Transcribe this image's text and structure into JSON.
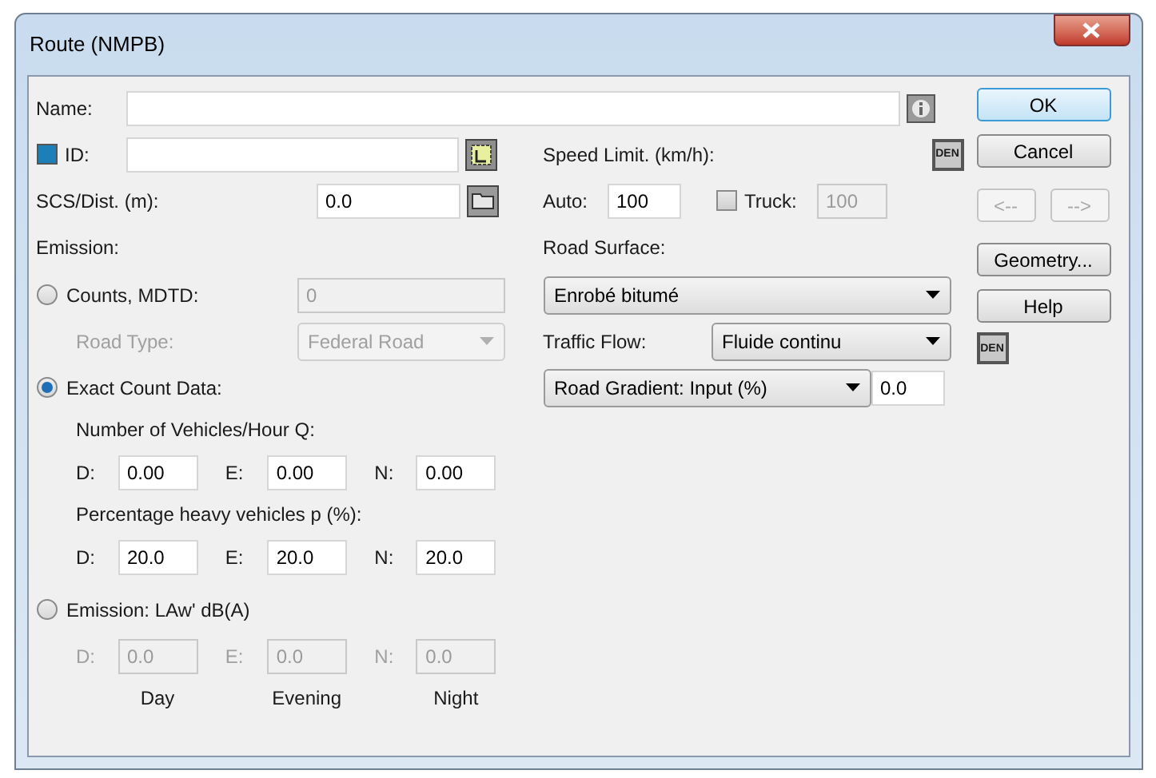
{
  "window": {
    "title": "Route (NMPB)"
  },
  "name": {
    "label": "Name:"
  },
  "id": {
    "label": "ID:",
    "checked": true
  },
  "scs_dist": {
    "label": "SCS/Dist. (m):",
    "value": "0.0"
  },
  "emission": {
    "label": "Emission:",
    "options": [
      {
        "kind": "counts",
        "label": "Counts, MDTD:",
        "selected": false,
        "value": "0",
        "road_type": {
          "label": "Road Type:",
          "value": "Federal Road"
        }
      },
      {
        "kind": "exact",
        "label": "Exact Count Data:",
        "selected": true,
        "groups": [
          {
            "label": "Number of Vehicles/Hour Q:",
            "fields": [
              {
                "label": "D:",
                "value": "0.00"
              },
              {
                "label": "E:",
                "value": "0.00"
              },
              {
                "label": "N:",
                "value": "0.00"
              }
            ]
          },
          {
            "label": "Percentage heavy vehicles p (%):",
            "fields": [
              {
                "label": "D:",
                "value": "20.0"
              },
              {
                "label": "E:",
                "value": "20.0"
              },
              {
                "label": "N:",
                "value": "20.0"
              }
            ]
          }
        ]
      },
      {
        "kind": "level",
        "label": "Emission: LAw' dB(A)",
        "selected": false,
        "fields": [
          {
            "label": "D:",
            "value": "0.0"
          },
          {
            "label": "E:",
            "value": "0.0"
          },
          {
            "label": "N:",
            "value": "0.0"
          }
        ]
      }
    ],
    "period_labels": [
      "Day",
      "Evening",
      "Night"
    ]
  },
  "speed_limit": {
    "label": "Speed Limit. (km/h):",
    "den": "DEN",
    "auto": {
      "label": "Auto:",
      "value": "100"
    },
    "truck": {
      "label": "Truck:",
      "value": "100",
      "checked": false
    }
  },
  "road_surface": {
    "label": "Road Surface:",
    "value": "Enrobé bitumé"
  },
  "traffic_flow": {
    "label": "Traffic Flow:",
    "value": "Fluide continu",
    "den": "DEN"
  },
  "road_gradient": {
    "mode": "Road Gradient: Input (%)",
    "value": "0.0"
  },
  "buttons": [
    {
      "label": "OK",
      "kind": "full",
      "default": true,
      "disabled": false
    },
    {
      "label": "Cancel",
      "kind": "full",
      "default": false,
      "disabled": false
    },
    {
      "label": "<--",
      "kind": "half",
      "default": false,
      "disabled": true
    },
    {
      "label": "-->",
      "kind": "half",
      "default": false,
      "disabled": true
    },
    {
      "label": "Geometry...",
      "kind": "full",
      "default": false,
      "disabled": false
    },
    {
      "label": "Help",
      "kind": "full",
      "default": false,
      "disabled": false
    }
  ]
}
